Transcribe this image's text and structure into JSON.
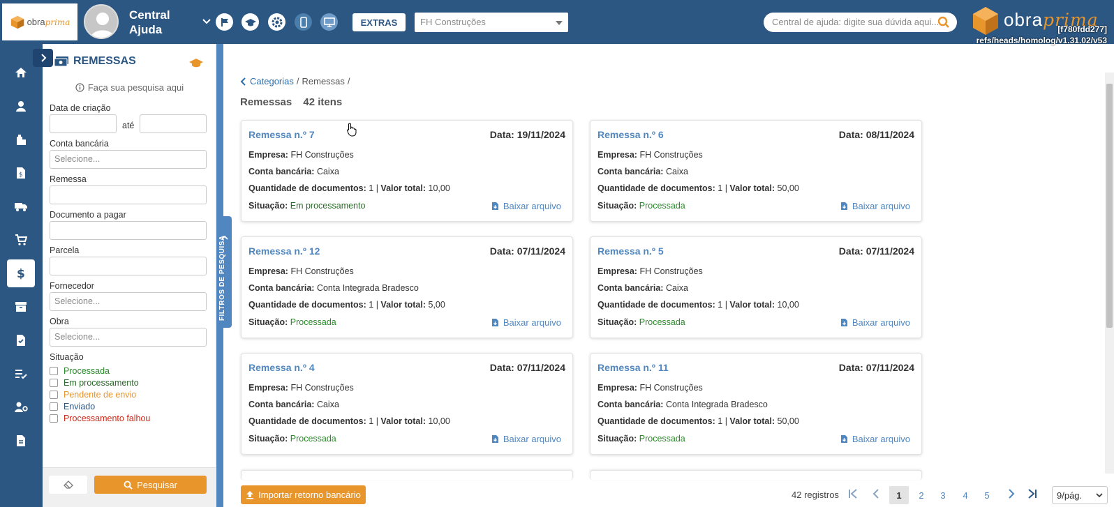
{
  "header": {
    "logo_text_a": "obra",
    "logo_text_b": "prima",
    "user_name": "Central Ajuda",
    "extras_label": "EXTRAS",
    "company_select": "FH Construções",
    "help_search_placeholder": "Central de ajuda: digite sua dúvida aqui...",
    "brand_text_a": "obra",
    "brand_text_b": "prima",
    "version_hash": "[f780fdd277]",
    "version_branch": "refs/heads/homolog/v1.31.02/v53"
  },
  "filter": {
    "title": "REMESSAS",
    "search_hint": "Faça sua pesquisa aqui",
    "date_label": "Data de criação",
    "date_separator": "até",
    "account_label": "Conta bancária",
    "account_placeholder": "Selecione...",
    "remessa_label": "Remessa",
    "document_label": "Documento a pagar",
    "parcela_label": "Parcela",
    "supplier_label": "Fornecedor",
    "supplier_placeholder": "Selecione...",
    "obra_label": "Obra",
    "obra_placeholder": "Selecione...",
    "status_label": "Situação",
    "statuses": [
      {
        "label": "Processada",
        "color": "#2a8a2a"
      },
      {
        "label": "Em processamento",
        "color": "#2a6a2a"
      },
      {
        "label": "Pendente de envio",
        "color": "#e8952c"
      },
      {
        "label": "Enviado",
        "color": "#2c5783"
      },
      {
        "label": "Processamento falhou",
        "color": "#cc2a1a"
      }
    ],
    "search_button": "Pesquisar",
    "side_tab": "FILTROS DE PESQUISA"
  },
  "main": {
    "breadcrumb_link": "Categorias",
    "breadcrumb_sep1": "/",
    "breadcrumb_current": "Remessas",
    "breadcrumb_sep2": "/",
    "heading": "Remessas",
    "heading_count": "42 itens",
    "labels": {
      "empresa": "Empresa:",
      "conta": "Conta bancária:",
      "quantidade": "Quantidade de documentos:",
      "valor": "Valor total:",
      "situacao": "Situação:",
      "separator": "|",
      "download": "Baixar arquivo"
    },
    "cards": [
      {
        "title": "Remessa n.º 7",
        "date": "Data: 19/11/2024",
        "empresa": "FH Construções",
        "conta": "Caixa",
        "quantidade": "1",
        "valor": "10,00",
        "situacao": "Em processamento"
      },
      {
        "title": "Remessa n.º 6",
        "date": "Data: 08/11/2024",
        "empresa": "FH Construções",
        "conta": "Caixa",
        "quantidade": "1",
        "valor": "50,00",
        "situacao": "Processada"
      },
      {
        "title": "Remessa n.º 12",
        "date": "Data: 07/11/2024",
        "empresa": "FH Construções",
        "conta": "Conta Integrada Bradesco",
        "quantidade": "1",
        "valor": "5,00",
        "situacao": "Processada"
      },
      {
        "title": "Remessa n.º 5",
        "date": "Data: 07/11/2024",
        "empresa": "FH Construções",
        "conta": "Caixa",
        "quantidade": "1",
        "valor": "10,00",
        "situacao": "Processada"
      },
      {
        "title": "Remessa n.º 4",
        "date": "Data: 07/11/2024",
        "empresa": "FH Construções",
        "conta": "Caixa",
        "quantidade": "1",
        "valor": "10,00",
        "situacao": "Processada"
      },
      {
        "title": "Remessa n.º 11",
        "date": "Data: 07/11/2024",
        "empresa": "FH Construções",
        "conta": "Conta Integrada Bradesco",
        "quantidade": "1",
        "valor": "50,00",
        "situacao": "Processada"
      }
    ]
  },
  "footer": {
    "import_button": "Importar retorno bancário",
    "records": "42 registros",
    "pages": [
      "1",
      "2",
      "3",
      "4",
      "5"
    ],
    "current_page": "1",
    "per_page": "9/pág."
  },
  "colors": {
    "primary": "#2c5783",
    "accent": "#e8952c",
    "link": "#5087c0",
    "success": "#2a8a2a"
  }
}
